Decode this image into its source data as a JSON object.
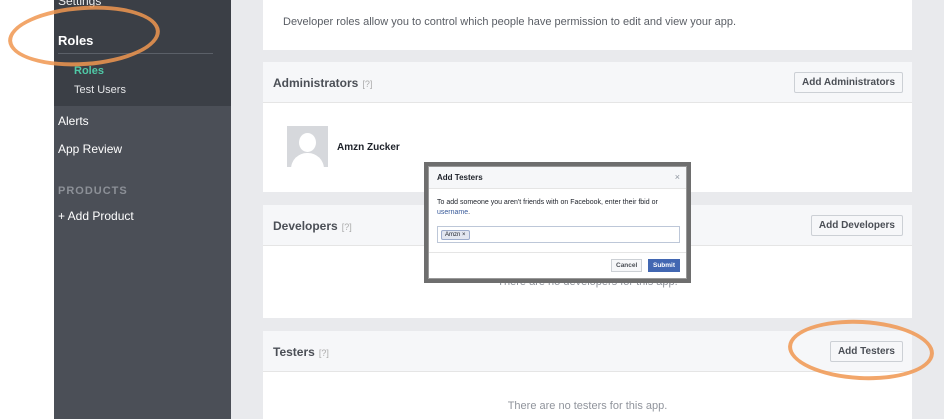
{
  "sidebar": {
    "settings_label": "Settings",
    "roles_label": "Roles",
    "sub_items": [
      "Roles",
      "Test Users"
    ],
    "alerts_label": "Alerts",
    "app_review_label": "App Review",
    "products_heading": "PRODUCTS",
    "add_product_label": "+ Add Product"
  },
  "intro_text": "Developer roles allow you to control which people have permission to edit and view your app.",
  "administrators": {
    "title": "Administrators",
    "help": "[?]",
    "add_button": "Add Administrators",
    "members": [
      {
        "name": "Amzn Zucker"
      }
    ]
  },
  "developers": {
    "title": "Developers",
    "help": "[?]",
    "add_button": "Add Developers",
    "empty_text": "There are no developers for this app."
  },
  "testers": {
    "title": "Testers",
    "help": "[?]",
    "add_button": "Add Testers",
    "empty_text": "There are no testers for this app."
  },
  "modal": {
    "title": "Add Testers",
    "close": "×",
    "description_prefix": "To add someone you aren't friends with on Facebook, enter their fbid or ",
    "description_link": "username",
    "description_suffix": ".",
    "token": "Amzn",
    "token_remove": "×",
    "cancel_label": "Cancel",
    "submit_label": "Submit"
  },
  "colors": {
    "sidebar_bg": "#4b4f57",
    "active_sub_item": "#4fc8a6",
    "submit_button": "#4267b2",
    "highlight_ring": "#f0964f"
  }
}
